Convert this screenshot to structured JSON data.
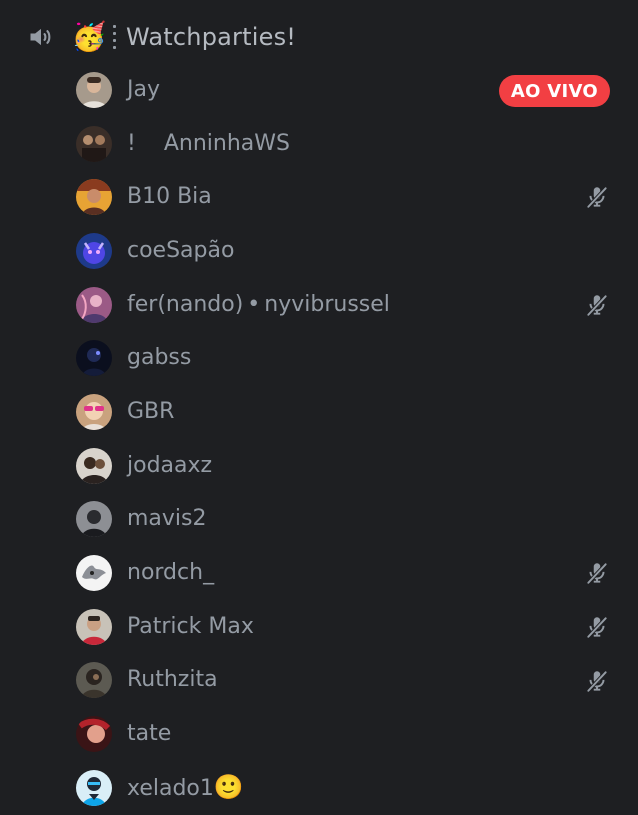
{
  "channel": {
    "icon": "speaker-icon",
    "emoji": "🥳",
    "name": "Watchparties!"
  },
  "colors": {
    "background": "#1e1f22",
    "text": "#949ba4",
    "live": "#f23f43"
  },
  "users": [
    {
      "name": "Jay",
      "live": "AO VIVO",
      "muted": false
    },
    {
      "prefix": "!",
      "name": "AnninhaWS",
      "muted": false
    },
    {
      "name": "B10 Bia",
      "muted": true
    },
    {
      "name": "coeSapão",
      "muted": false
    },
    {
      "name": "fer(nando)",
      "separator": "•",
      "extra": "nyvibrussel",
      "muted": true
    },
    {
      "name": "gabss",
      "muted": false
    },
    {
      "name": "GBR",
      "muted": false
    },
    {
      "name": "jodaaxz",
      "muted": false
    },
    {
      "name": "mavis2",
      "muted": false
    },
    {
      "name": "nordch_",
      "muted": true
    },
    {
      "name": "Patrick Max",
      "muted": true
    },
    {
      "name": "Ruthzita",
      "muted": true
    },
    {
      "name": "tate",
      "muted": false
    },
    {
      "name": "xelado1",
      "emoji": "🙂",
      "muted": false
    }
  ]
}
